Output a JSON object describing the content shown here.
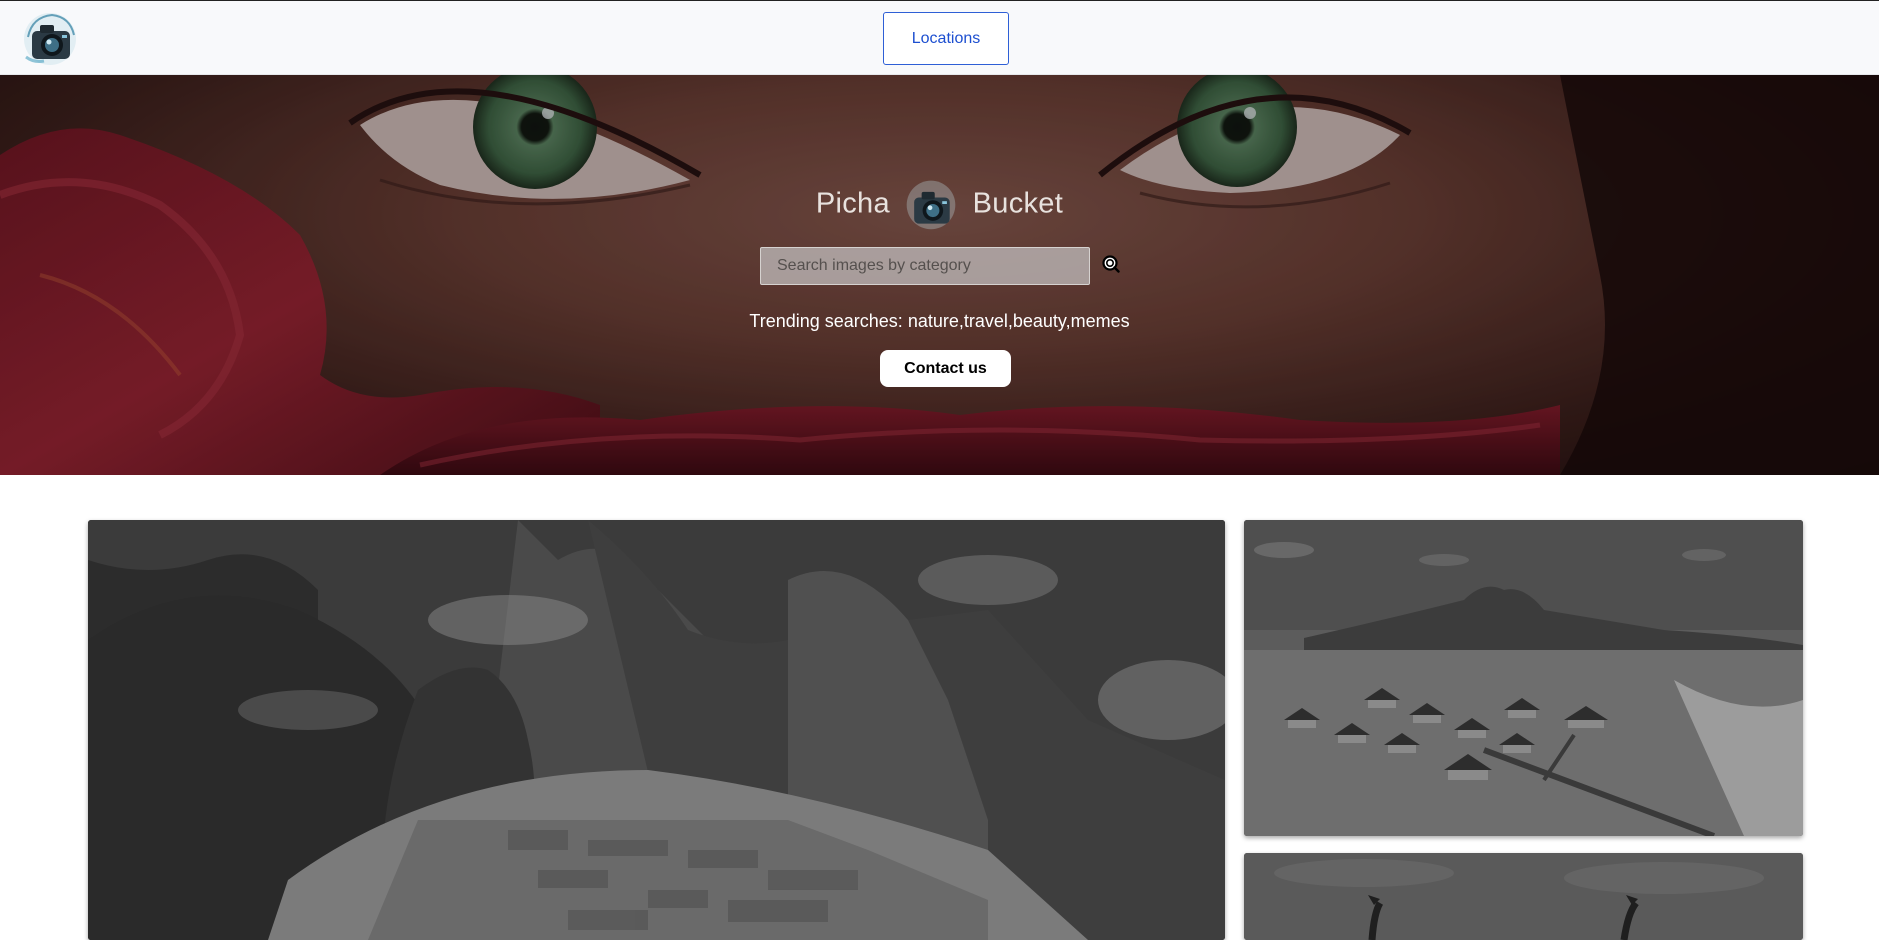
{
  "navbar": {
    "logo_icon": "camera-icon",
    "locations_label": "Locations",
    "accent_color": "#1d4fd0"
  },
  "hero": {
    "title_left": "Picha",
    "title_right": "Bucket",
    "title_icon": "camera-icon",
    "search": {
      "placeholder": "Search images by category",
      "value": "",
      "icon": "search-icon"
    },
    "trending_label": "Trending searches:",
    "trending_terms": "nature,travel,beauty,memes",
    "contact_label": "Contact us"
  },
  "gallery": {
    "images": [
      {
        "name": "mountain-ruins-image",
        "tone": "grayscale"
      },
      {
        "name": "overwater-bungalows-image",
        "tone": "grayscale"
      },
      {
        "name": "palm-trees-image",
        "tone": "grayscale"
      }
    ]
  }
}
